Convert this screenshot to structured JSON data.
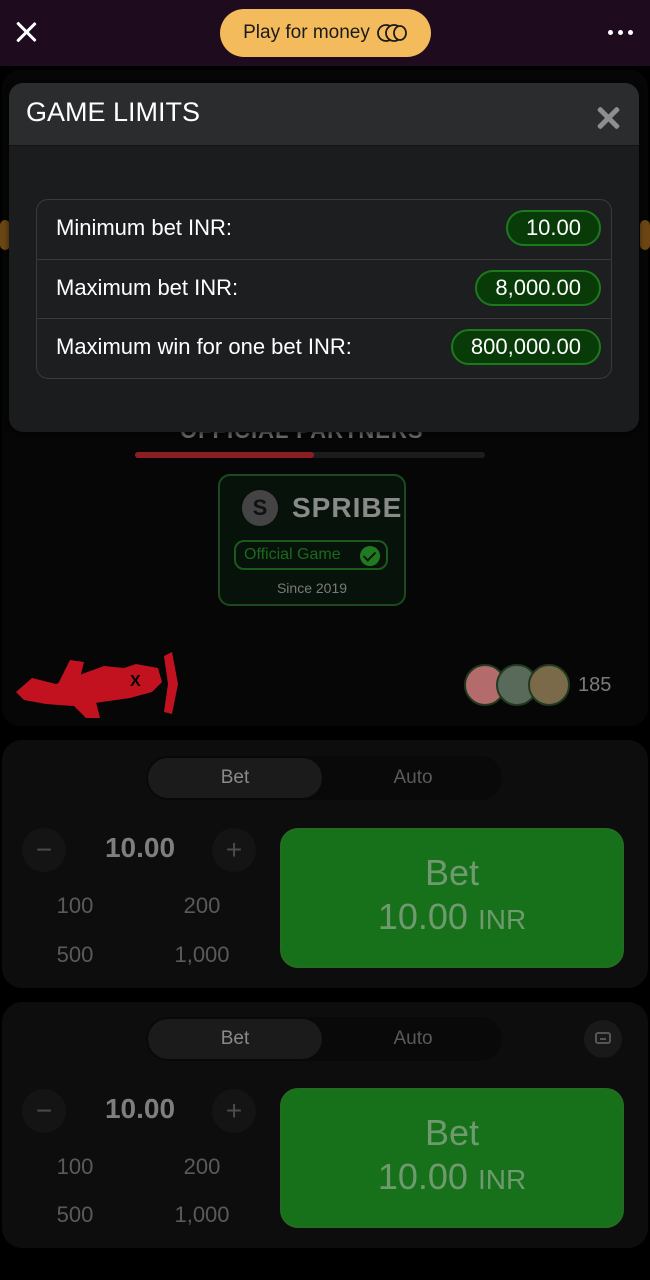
{
  "topbar": {
    "play_label": "Play for money"
  },
  "game": {
    "partners_label": "OFFICIAL PARTNERS",
    "provider": {
      "name": "SPRIBE",
      "logo_letter": "S",
      "badge": "Official Game",
      "since": "Since 2019"
    },
    "loading_progress": 0.51,
    "online_count": "185"
  },
  "modal": {
    "title": "GAME LIMITS",
    "rows": [
      {
        "label": "Minimum bet INR:",
        "value": "10.00"
      },
      {
        "label": "Maximum bet INR:",
        "value": "8,000.00"
      },
      {
        "label": "Maximum win for one bet INR:",
        "value": "800,000.00"
      }
    ]
  },
  "bet_panels": [
    {
      "tabs": {
        "bet": "Bet",
        "auto": "Auto"
      },
      "minus": "−",
      "plus": "+",
      "amount": "10.00",
      "quick": [
        "100",
        "200",
        "500",
        "1,000"
      ],
      "button": {
        "label": "Bet",
        "amount": "10.00",
        "currency": "INR"
      }
    },
    {
      "tabs": {
        "bet": "Bet",
        "auto": "Auto"
      },
      "minus": "−",
      "plus": "+",
      "amount": "10.00",
      "quick": [
        "100",
        "200",
        "500",
        "1,000"
      ],
      "button": {
        "label": "Bet",
        "amount": "10.00",
        "currency": "INR"
      }
    }
  ],
  "colors": {
    "accent": "#f3bb5c",
    "bet_button": "#17711a",
    "limit_pill_border": "#1c7a1c"
  },
  "icons": [
    "close-icon",
    "coins-icon",
    "more-icon",
    "check-icon",
    "plane-icon",
    "collapse-icon"
  ]
}
